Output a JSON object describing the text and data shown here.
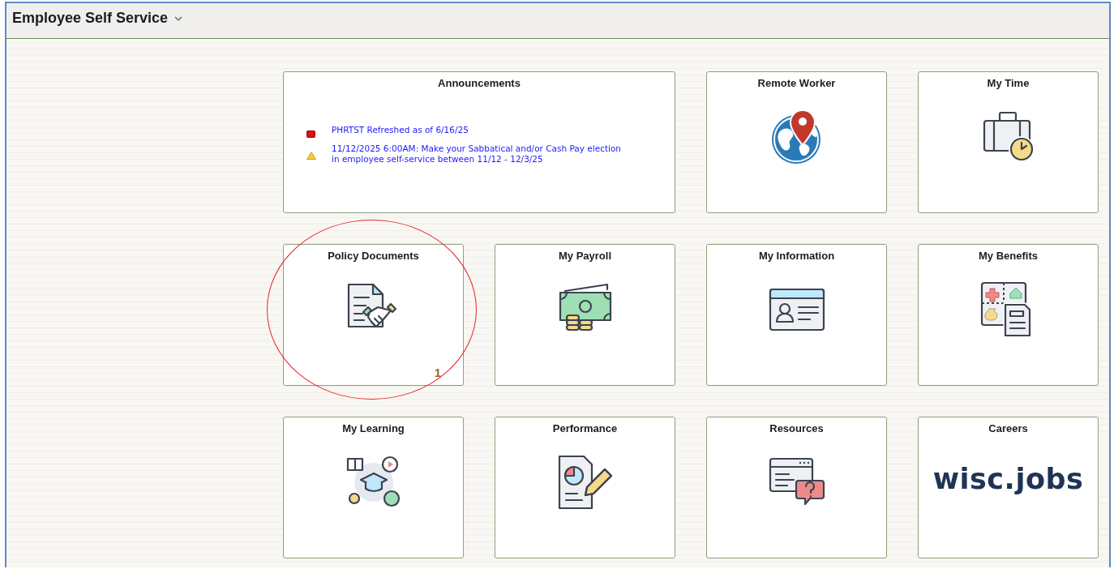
{
  "header": {
    "title": "Employee Self Service"
  },
  "tiles": [
    {
      "kind": "announcements",
      "title": "Announcements",
      "items": [
        {
          "kind": "error",
          "lines": [
            "PHRTST Refreshed as of 6/16/25"
          ]
        },
        {
          "kind": "warning",
          "lines": [
            "11/12/2025 6:00AM: Make your Sabbatical and/or Cash Pay election",
            "in employee self-service between 11/12 - 12/3/25"
          ]
        }
      ]
    },
    {
      "kind": "icon",
      "title": "Remote Worker"
    },
    {
      "kind": "icon",
      "title": "My Time"
    },
    {
      "kind": "icon",
      "title": "Policy Documents",
      "count": "1",
      "circled": true
    },
    {
      "kind": "icon",
      "title": "My Payroll"
    },
    {
      "kind": "icon",
      "title": "My Information"
    },
    {
      "kind": "icon",
      "title": "My Benefits"
    },
    {
      "kind": "icon",
      "title": "My Learning"
    },
    {
      "kind": "icon",
      "title": "Performance"
    },
    {
      "kind": "icon",
      "title": "Resources"
    },
    {
      "kind": "logo",
      "title": "Careers",
      "logo_text": "wisc.jobs"
    }
  ]
}
